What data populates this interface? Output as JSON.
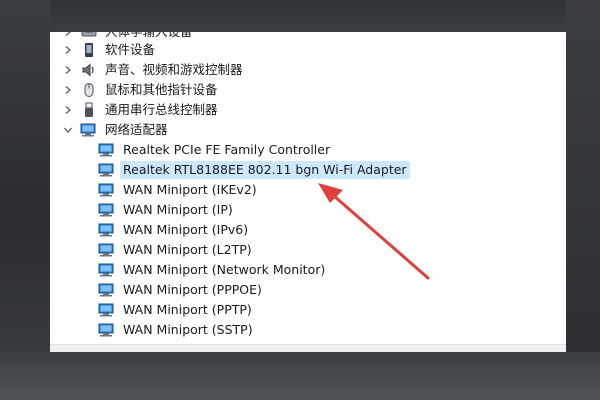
{
  "categories": [
    {
      "label": "人体学输入设备",
      "icon": "hid-icon"
    },
    {
      "label": "软件设备",
      "icon": "software-device-icon"
    },
    {
      "label": "声音、视频和游戏控制器",
      "icon": "speaker-icon"
    },
    {
      "label": "鼠标和其他指针设备",
      "icon": "mouse-icon"
    },
    {
      "label": "通用串行总线控制器",
      "icon": "usb-icon"
    },
    {
      "label": "网络适配器",
      "icon": "network-adapter-icon",
      "expanded": true
    }
  ],
  "network_adapters": [
    {
      "label": "Realtek PCIe FE Family Controller"
    },
    {
      "label": "Realtek RTL8188EE 802.11 bgn Wi-Fi Adapter",
      "selected": true
    },
    {
      "label": "WAN Miniport (IKEv2)"
    },
    {
      "label": "WAN Miniport (IP)"
    },
    {
      "label": "WAN Miniport (IPv6)"
    },
    {
      "label": "WAN Miniport (L2TP)"
    },
    {
      "label": "WAN Miniport (Network Monitor)"
    },
    {
      "label": "WAN Miniport (PPPOE)"
    },
    {
      "label": "WAN Miniport (PPTP)"
    },
    {
      "label": "WAN Miniport (SSTP)"
    }
  ],
  "colors": {
    "selection": "#cce8ff",
    "annotation_arrow": "#e0403a",
    "adapter_icon": "#2a7fd4"
  },
  "annotation": {
    "icon": "red-arrow-icon",
    "points_to": "Realtek RTL8188EE 802.11 bgn Wi-Fi Adapter"
  }
}
